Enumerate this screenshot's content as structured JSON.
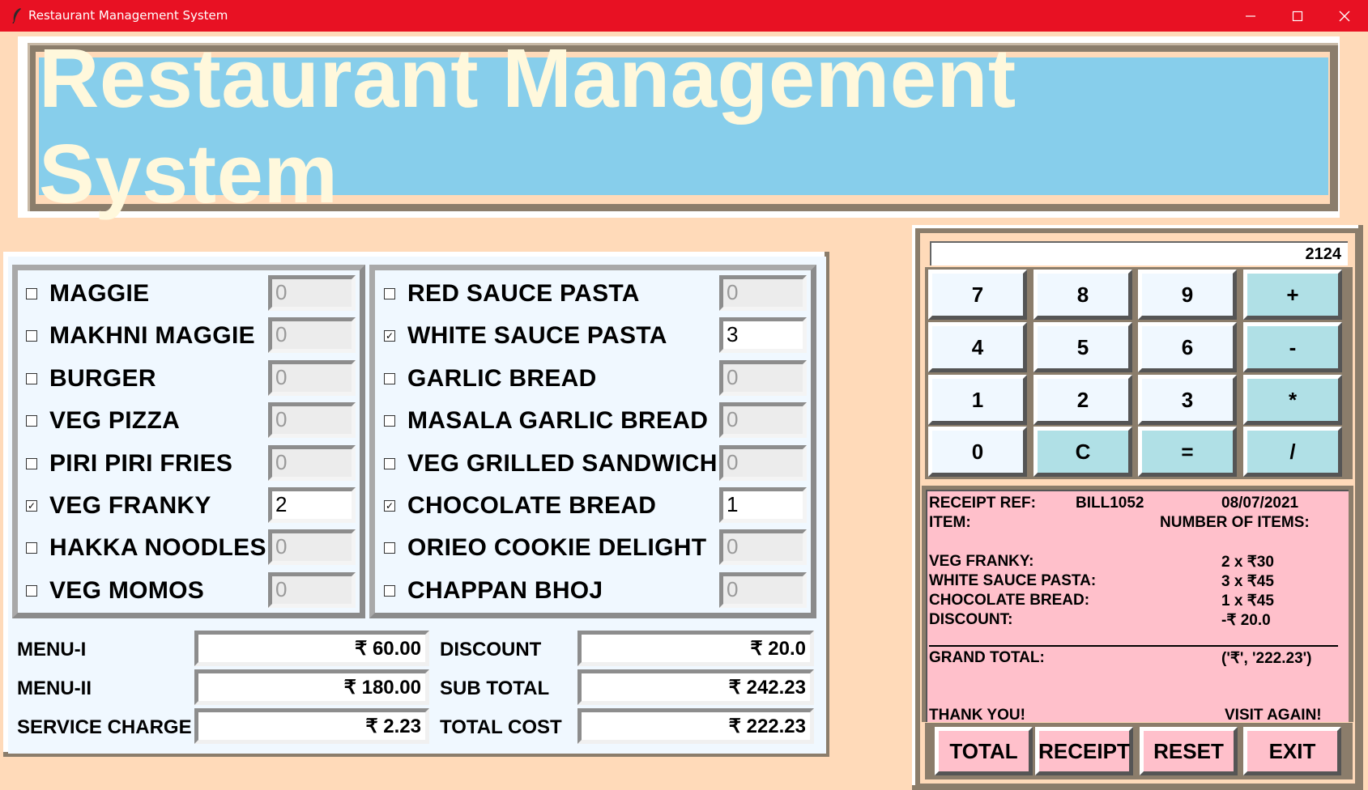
{
  "window": {
    "title": "Restaurant Management System",
    "titlebar_color": "#e81123"
  },
  "header": {
    "title": "Restaurant Management System"
  },
  "menu1": [
    {
      "name": "MAGGIE",
      "checked": false,
      "qty": "0"
    },
    {
      "name": "MAKHNI MAGGIE",
      "checked": false,
      "qty": "0"
    },
    {
      "name": "BURGER",
      "checked": false,
      "qty": "0"
    },
    {
      "name": "VEG PIZZA",
      "checked": false,
      "qty": "0"
    },
    {
      "name": "PIRI PIRI FRIES",
      "checked": false,
      "qty": "0"
    },
    {
      "name": "VEG FRANKY",
      "checked": true,
      "qty": "2"
    },
    {
      "name": "HAKKA NOODLES",
      "checked": false,
      "qty": "0"
    },
    {
      "name": "VEG MOMOS",
      "checked": false,
      "qty": "0"
    }
  ],
  "menu2": [
    {
      "name": "RED SAUCE PASTA",
      "checked": false,
      "qty": "0"
    },
    {
      "name": "WHITE SAUCE PASTA",
      "checked": true,
      "qty": "3"
    },
    {
      "name": "GARLIC BREAD",
      "checked": false,
      "qty": "0"
    },
    {
      "name": "MASALA GARLIC BREAD",
      "checked": false,
      "qty": "0"
    },
    {
      "name": "VEG GRILLED SANDWICH",
      "checked": false,
      "qty": "0"
    },
    {
      "name": "CHOCOLATE BREAD",
      "checked": true,
      "qty": "1"
    },
    {
      "name": "ORIEO COOKIE DELIGHT",
      "checked": false,
      "qty": "0"
    },
    {
      "name": "CHAPPAN BHOJ",
      "checked": false,
      "qty": "0"
    }
  ],
  "costs": {
    "menu1_label": "MENU-I",
    "menu1_value": "₹ 60.00",
    "menu2_label": "MENU-II",
    "menu2_value": "₹ 180.00",
    "service_label": "SERVICE CHARGE",
    "service_value": "₹ 2.23",
    "discount_label": "DISCOUNT",
    "discount_value": "₹ 20.0",
    "subtotal_label": "SUB TOTAL",
    "subtotal_value": "₹ 242.23",
    "total_label": "TOTAL COST",
    "total_value": "₹ 222.23"
  },
  "calculator": {
    "display": "2124",
    "buttons": [
      [
        "7",
        "8",
        "9",
        "+"
      ],
      [
        "4",
        "5",
        "6",
        "-"
      ],
      [
        "1",
        "2",
        "3",
        "*"
      ],
      [
        "0",
        "C",
        "=",
        "/"
      ]
    ]
  },
  "receipt": {
    "ref_label": "RECEIPT REF:",
    "ref_value": "BILL1052",
    "date": "08/07/2021",
    "item_label": "ITEM:",
    "count_label": "NUMBER OF ITEMS:",
    "lines": [
      {
        "item": "VEG FRANKY:",
        "qty": "2  x ₹30"
      },
      {
        "item": "WHITE SAUCE PASTA:",
        "qty": "3  x ₹45"
      },
      {
        "item": "CHOCOLATE BREAD:",
        "qty": "1  x ₹45"
      },
      {
        "item": "DISCOUNT:",
        "qty": "-₹ 20.0"
      }
    ],
    "grand_label": "GRAND TOTAL:",
    "grand_value": "('₹', '222.23')",
    "thanks": "THANK YOU!",
    "visit": "VISIT AGAIN!"
  },
  "actions": {
    "total": "TOTAL",
    "receipt": "RECEIPT",
    "reset": "RESET",
    "exit": "EXIT"
  },
  "colors": {
    "background": "#ffdab9",
    "banner": "#87ceeb",
    "banner_text": "#fff8dc",
    "receipt": "#ffc0cb",
    "operator_btn": "#b0e0e6",
    "frame": "#8b7d6b"
  }
}
